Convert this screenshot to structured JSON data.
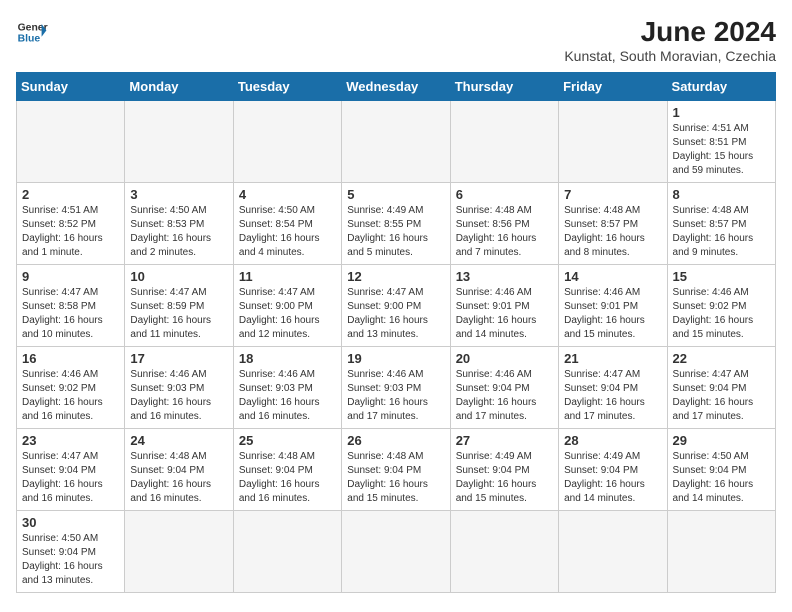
{
  "header": {
    "logo_general": "General",
    "logo_blue": "Blue",
    "title": "June 2024",
    "location": "Kunstat, South Moravian, Czechia"
  },
  "days_of_week": [
    "Sunday",
    "Monday",
    "Tuesday",
    "Wednesday",
    "Thursday",
    "Friday",
    "Saturday"
  ],
  "weeks": [
    [
      {
        "day": "",
        "info": ""
      },
      {
        "day": "",
        "info": ""
      },
      {
        "day": "",
        "info": ""
      },
      {
        "day": "",
        "info": ""
      },
      {
        "day": "",
        "info": ""
      },
      {
        "day": "",
        "info": ""
      },
      {
        "day": "1",
        "info": "Sunrise: 4:51 AM\nSunset: 8:51 PM\nDaylight: 15 hours and 59 minutes."
      }
    ],
    [
      {
        "day": "2",
        "info": "Sunrise: 4:51 AM\nSunset: 8:52 PM\nDaylight: 16 hours and 1 minute."
      },
      {
        "day": "3",
        "info": "Sunrise: 4:50 AM\nSunset: 8:53 PM\nDaylight: 16 hours and 2 minutes."
      },
      {
        "day": "4",
        "info": "Sunrise: 4:50 AM\nSunset: 8:54 PM\nDaylight: 16 hours and 4 minutes."
      },
      {
        "day": "5",
        "info": "Sunrise: 4:49 AM\nSunset: 8:55 PM\nDaylight: 16 hours and 5 minutes."
      },
      {
        "day": "6",
        "info": "Sunrise: 4:48 AM\nSunset: 8:56 PM\nDaylight: 16 hours and 7 minutes."
      },
      {
        "day": "7",
        "info": "Sunrise: 4:48 AM\nSunset: 8:57 PM\nDaylight: 16 hours and 8 minutes."
      },
      {
        "day": "8",
        "info": "Sunrise: 4:48 AM\nSunset: 8:57 PM\nDaylight: 16 hours and 9 minutes."
      }
    ],
    [
      {
        "day": "9",
        "info": "Sunrise: 4:47 AM\nSunset: 8:58 PM\nDaylight: 16 hours and 10 minutes."
      },
      {
        "day": "10",
        "info": "Sunrise: 4:47 AM\nSunset: 8:59 PM\nDaylight: 16 hours and 11 minutes."
      },
      {
        "day": "11",
        "info": "Sunrise: 4:47 AM\nSunset: 9:00 PM\nDaylight: 16 hours and 12 minutes."
      },
      {
        "day": "12",
        "info": "Sunrise: 4:47 AM\nSunset: 9:00 PM\nDaylight: 16 hours and 13 minutes."
      },
      {
        "day": "13",
        "info": "Sunrise: 4:46 AM\nSunset: 9:01 PM\nDaylight: 16 hours and 14 minutes."
      },
      {
        "day": "14",
        "info": "Sunrise: 4:46 AM\nSunset: 9:01 PM\nDaylight: 16 hours and 15 minutes."
      },
      {
        "day": "15",
        "info": "Sunrise: 4:46 AM\nSunset: 9:02 PM\nDaylight: 16 hours and 15 minutes."
      }
    ],
    [
      {
        "day": "16",
        "info": "Sunrise: 4:46 AM\nSunset: 9:02 PM\nDaylight: 16 hours and 16 minutes."
      },
      {
        "day": "17",
        "info": "Sunrise: 4:46 AM\nSunset: 9:03 PM\nDaylight: 16 hours and 16 minutes."
      },
      {
        "day": "18",
        "info": "Sunrise: 4:46 AM\nSunset: 9:03 PM\nDaylight: 16 hours and 16 minutes."
      },
      {
        "day": "19",
        "info": "Sunrise: 4:46 AM\nSunset: 9:03 PM\nDaylight: 16 hours and 17 minutes."
      },
      {
        "day": "20",
        "info": "Sunrise: 4:46 AM\nSunset: 9:04 PM\nDaylight: 16 hours and 17 minutes."
      },
      {
        "day": "21",
        "info": "Sunrise: 4:47 AM\nSunset: 9:04 PM\nDaylight: 16 hours and 17 minutes."
      },
      {
        "day": "22",
        "info": "Sunrise: 4:47 AM\nSunset: 9:04 PM\nDaylight: 16 hours and 17 minutes."
      }
    ],
    [
      {
        "day": "23",
        "info": "Sunrise: 4:47 AM\nSunset: 9:04 PM\nDaylight: 16 hours and 16 minutes."
      },
      {
        "day": "24",
        "info": "Sunrise: 4:48 AM\nSunset: 9:04 PM\nDaylight: 16 hours and 16 minutes."
      },
      {
        "day": "25",
        "info": "Sunrise: 4:48 AM\nSunset: 9:04 PM\nDaylight: 16 hours and 16 minutes."
      },
      {
        "day": "26",
        "info": "Sunrise: 4:48 AM\nSunset: 9:04 PM\nDaylight: 16 hours and 15 minutes."
      },
      {
        "day": "27",
        "info": "Sunrise: 4:49 AM\nSunset: 9:04 PM\nDaylight: 16 hours and 15 minutes."
      },
      {
        "day": "28",
        "info": "Sunrise: 4:49 AM\nSunset: 9:04 PM\nDaylight: 16 hours and 14 minutes."
      },
      {
        "day": "29",
        "info": "Sunrise: 4:50 AM\nSunset: 9:04 PM\nDaylight: 16 hours and 14 minutes."
      }
    ],
    [
      {
        "day": "30",
        "info": "Sunrise: 4:50 AM\nSunset: 9:04 PM\nDaylight: 16 hours and 13 minutes."
      },
      {
        "day": "",
        "info": ""
      },
      {
        "day": "",
        "info": ""
      },
      {
        "day": "",
        "info": ""
      },
      {
        "day": "",
        "info": ""
      },
      {
        "day": "",
        "info": ""
      },
      {
        "day": "",
        "info": ""
      }
    ]
  ]
}
